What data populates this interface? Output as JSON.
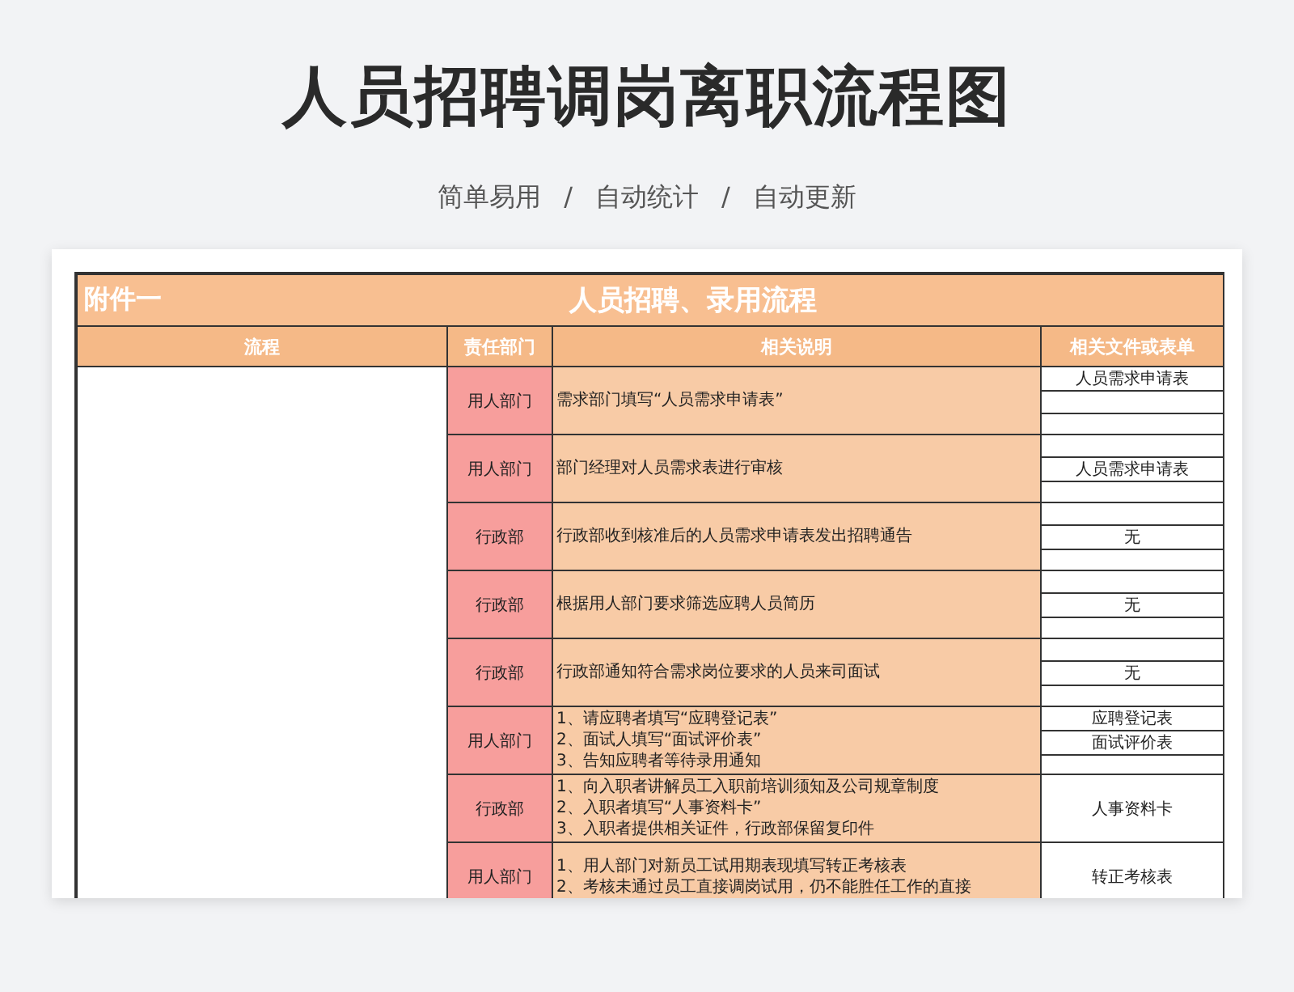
{
  "page": {
    "title": "人员招聘调岗离职流程图",
    "subtitle": [
      "简单易用",
      "自动统计",
      "自动更新"
    ],
    "separator": "/"
  },
  "sheet": {
    "tag": "附件一",
    "title": "人员招聘、录用流程",
    "columns": [
      "流程",
      "责任部门",
      "相关说明",
      "相关文件或表单"
    ],
    "rows": [
      {
        "department": "用人部门",
        "description": [
          "需求部门填写“人员需求申请表”"
        ],
        "kind": "lined",
        "files": [
          {
            "kind": "file",
            "label": "人员需求申请表"
          },
          {
            "kind": "blank"
          },
          {
            "kind": "blank"
          }
        ]
      },
      {
        "department": "用人部门",
        "description": [
          "部门经理对人员需求表进行审核"
        ],
        "kind": "lined",
        "files": [
          {
            "kind": "blank"
          },
          {
            "kind": "file",
            "label": "人员需求申请表"
          },
          {
            "kind": "blank"
          }
        ]
      },
      {
        "department": "行政部",
        "description": [
          "行政部收到核准后的人员需求申请表发出招聘通告"
        ],
        "kind": "lined",
        "files": [
          {
            "kind": "blank"
          },
          {
            "kind": "file",
            "label": "无"
          },
          {
            "kind": "blank"
          }
        ]
      },
      {
        "department": "行政部",
        "description": [
          "根据用人部门要求筛选应聘人员简历"
        ],
        "kind": "lined",
        "files": [
          {
            "kind": "blank"
          },
          {
            "kind": "file",
            "label": "无"
          },
          {
            "kind": "blank"
          }
        ]
      },
      {
        "department": "行政部",
        "description": [
          "行政部通知符合需求岗位要求的人员来司面试"
        ],
        "kind": "lined",
        "files": [
          {
            "kind": "blank"
          },
          {
            "kind": "file",
            "label": "无"
          },
          {
            "kind": "blank"
          }
        ]
      },
      {
        "department": "用人部门",
        "description": [
          "1、请应聘者填写“应聘登记表”",
          "2、面试人填写“面试评价表”",
          "3、告知应聘者等待录用通知"
        ],
        "kind": "lined",
        "files": [
          {
            "kind": "file",
            "label": "应聘登记表"
          },
          {
            "kind": "file",
            "label": "面试评价表"
          },
          {
            "kind": "blank"
          }
        ]
      },
      {
        "department": "行政部",
        "description": [
          "1、向入职者讲解员工入职前培训须知及公司规章制度",
          "2、入职者填写“人事资料卡”",
          "3、入职者提供相关证件，行政部保留复印件"
        ],
        "kind": "merged",
        "files": [
          {
            "kind": "file",
            "label": "人事资料卡"
          }
        ]
      },
      {
        "department": "用人部门",
        "description": [
          "1、用人部门对新员工试用期表现填写转正考核表",
          "2、考核未通过员工直接调岗试用，仍不能胜任工作的直接"
        ],
        "kind": "merged",
        "files": [
          {
            "kind": "file",
            "label": "转正考核表"
          }
        ]
      }
    ]
  }
}
